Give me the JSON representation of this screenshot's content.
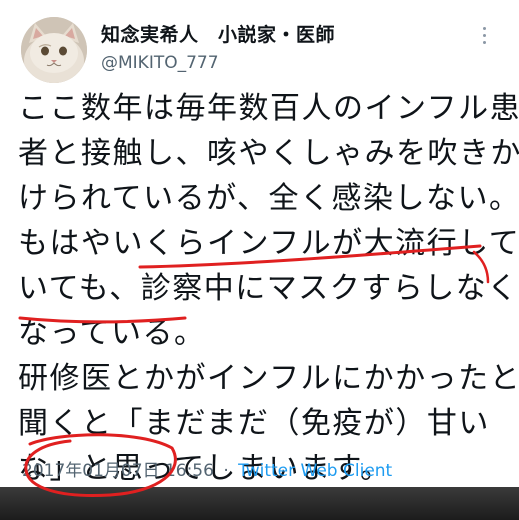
{
  "author": {
    "display_name": "知念実希人　小説家・医師",
    "handle": "@MIKITO_777"
  },
  "icons": {
    "avatar": "cat-avatar",
    "menu": "more-options-icon"
  },
  "tweet": {
    "lines": [
      "ここ数年は毎年数百人のインフル患",
      "者と接触し、咳やくしゃみを吹きか",
      "けられているが、全く感染しない。",
      "もはやいくらインフルが大流行して",
      "いても、診察中にマスクすらしなく",
      "なっている。",
      "研修医とかがインフルにかかったと",
      "聞くと「まだまだ（免疫が）甘い",
      "な」と思ってしまいます。"
    ],
    "date": "2017年01月07日",
    "time": "16:56",
    "separator": "·",
    "client": "Twitter Web Client"
  },
  "colors": {
    "handle_gray": "#536471",
    "client_blue": "#1d9bf0",
    "annotation_red": "#e02020"
  }
}
